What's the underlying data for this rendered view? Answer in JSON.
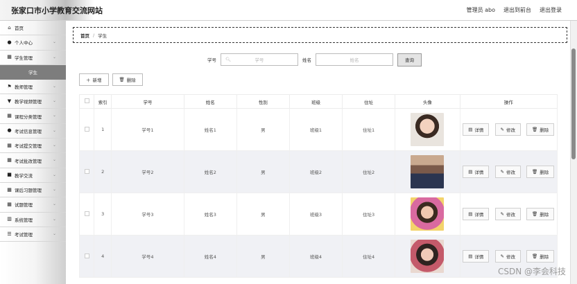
{
  "header": {
    "site_title": "张家口市小学教育交流网站",
    "admin_label": "管理员 abo",
    "back_front": "退出到前台",
    "logout": "退出登录"
  },
  "sidebar": {
    "items": [
      {
        "label": "首页",
        "icon": "home-icon",
        "glyph": "⌂",
        "chevron": false
      },
      {
        "label": "个人中心",
        "icon": "user-icon",
        "glyph": "●",
        "chevron": true
      },
      {
        "label": "学生管理",
        "icon": "grid-icon",
        "glyph": "▦",
        "chevron": true
      },
      {
        "label": "教师管理",
        "icon": "flag-icon",
        "glyph": "⚑",
        "chevron": true
      },
      {
        "label": "教学视频管理",
        "icon": "video-icon",
        "glyph": "▼",
        "chevron": true
      },
      {
        "label": "课程分类管理",
        "icon": "grid-icon",
        "glyph": "▦",
        "chevron": true
      },
      {
        "label": "考试信息管理",
        "icon": "pin-icon",
        "glyph": "●",
        "chevron": true
      },
      {
        "label": "考试提交管理",
        "icon": "grid-icon",
        "glyph": "▦",
        "chevron": true
      },
      {
        "label": "考试批改管理",
        "icon": "grid-icon",
        "glyph": "▦",
        "chevron": true
      },
      {
        "label": "教学交流",
        "icon": "chat-icon",
        "glyph": "■",
        "chevron": true
      },
      {
        "label": "课后习题管理",
        "icon": "grid-icon",
        "glyph": "▦",
        "chevron": true
      },
      {
        "label": "试题管理",
        "icon": "grid-icon",
        "glyph": "▦",
        "chevron": true
      },
      {
        "label": "系统管理",
        "icon": "system-icon",
        "glyph": "▥",
        "chevron": true
      },
      {
        "label": "考试管理",
        "icon": "list-icon",
        "glyph": "☰",
        "chevron": true
      }
    ],
    "active_sub": "学生"
  },
  "breadcrumb": {
    "home": "首页",
    "sep": "/",
    "current": "学生"
  },
  "search": {
    "student_no_label": "学号",
    "student_no_placeholder": "学号",
    "name_label": "姓名",
    "name_placeholder": "姓名",
    "query_btn": "查询"
  },
  "toolbar": {
    "add": "新增",
    "delete": "删除"
  },
  "table": {
    "columns": [
      "索引",
      "学号",
      "姓名",
      "性别",
      "班级",
      "住址",
      "头像",
      "操作"
    ],
    "rows": [
      {
        "index": "1",
        "no": "学号1",
        "name": "姓名1",
        "gender": "男",
        "class": "班级1",
        "address": "住址1"
      },
      {
        "index": "2",
        "no": "学号2",
        "name": "姓名2",
        "gender": "男",
        "class": "班级2",
        "address": "住址2"
      },
      {
        "index": "3",
        "no": "学号3",
        "name": "姓名3",
        "gender": "男",
        "class": "班级3",
        "address": "住址3"
      },
      {
        "index": "4",
        "no": "学号4",
        "name": "姓名4",
        "gender": "男",
        "class": "班级4",
        "address": "住址4"
      }
    ],
    "ops": {
      "detail": "详情",
      "edit": "修改",
      "delete": "删除"
    }
  },
  "watermark": "CSDN @李会科技"
}
